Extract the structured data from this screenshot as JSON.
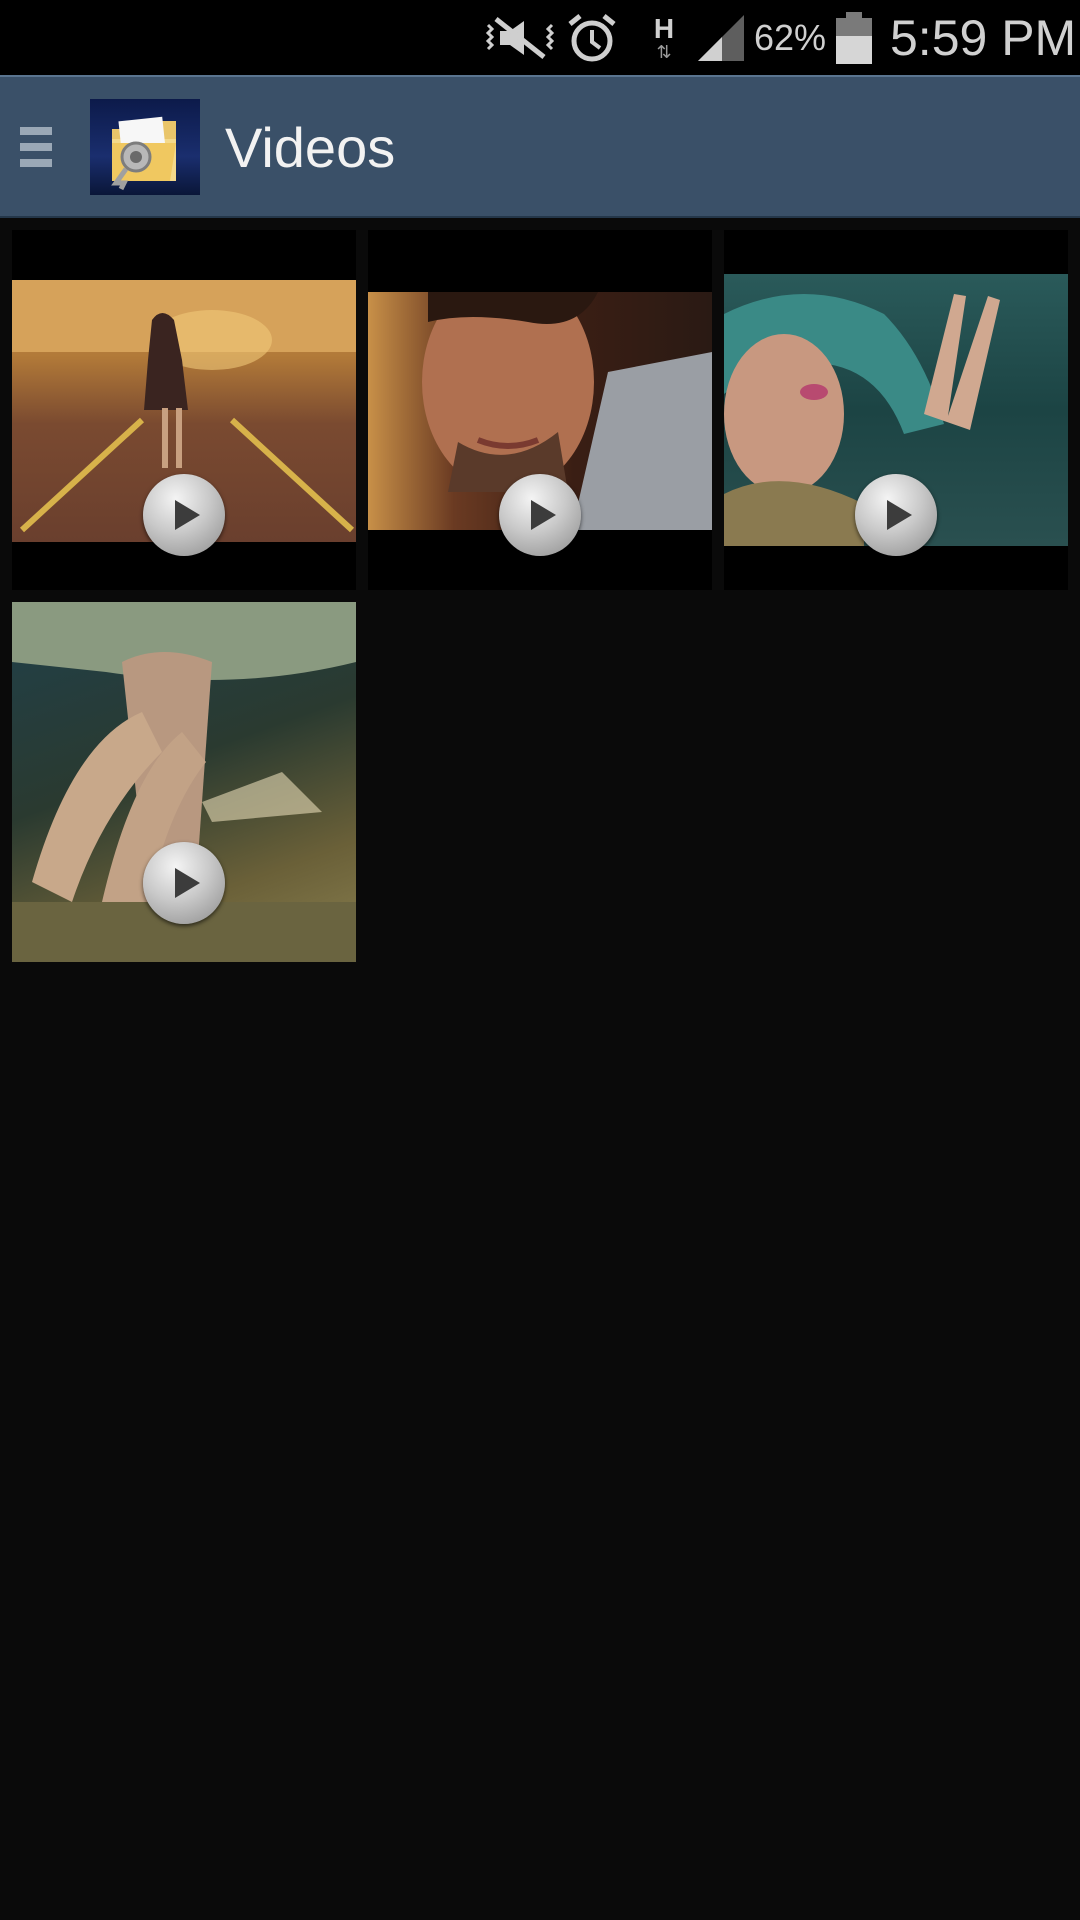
{
  "status_bar": {
    "icons": [
      "mute-vibrate-icon",
      "alarm-icon",
      "hspa-data-icon",
      "signal-icon",
      "battery-icon"
    ],
    "data_type": "H",
    "battery_percent": "62%",
    "time": "5:59 PM"
  },
  "action_bar": {
    "menu_icon": "menu-icon",
    "app_logo_icon": "secure-folder-icon",
    "title": "Videos"
  },
  "videos": [
    {
      "thumbnail": "video-thumbnail-woman-on-runway",
      "play_icon": "play-icon"
    },
    {
      "thumbnail": "video-thumbnail-man-closeup",
      "play_icon": "play-icon"
    },
    {
      "thumbnail": "video-thumbnail-woman-in-hat",
      "play_icon": "play-icon"
    },
    {
      "thumbnail": "video-thumbnail-hand-on-ground",
      "play_icon": "play-icon"
    }
  ],
  "colors": {
    "action_bar": "#3a5068",
    "background": "#0a0a0a",
    "status_bar": "#000000"
  }
}
